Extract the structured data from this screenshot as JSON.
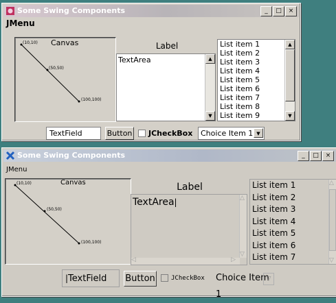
{
  "window_top": {
    "title": "Some Swing Components",
    "controls": [
      "_",
      "□",
      "×"
    ],
    "menu": "JMenu",
    "canvas": {
      "title": "Canvas",
      "points": [
        "(10,10)",
        "(50,50)",
        "(100,100)"
      ]
    },
    "label": "Label",
    "textarea": "TextArea",
    "list": [
      "List item 1",
      "List item 2",
      "List item 3",
      "List item 4",
      "List item 5",
      "List item 6",
      "List item 7",
      "List item 8",
      "List item 9"
    ],
    "textfield": "TextField",
    "button": "Button",
    "checkbox": "JCheckBox",
    "choice": "Choice Item 1"
  },
  "window_bottom": {
    "title": "Some Swing Components",
    "controls": [
      "_",
      "□",
      "×"
    ],
    "menu": "JMenu",
    "canvas": {
      "title": "Canvas",
      "points": [
        "(10,10)",
        "(50,50)",
        "(100,100)"
      ]
    },
    "label": "Label",
    "textarea": "TextArea",
    "list": [
      "List item 1",
      "List item 2",
      "List item 3",
      "List item 4",
      "List item 5",
      "List item 6",
      "List item 7"
    ],
    "textfield": "TextField",
    "button": "Button",
    "checkbox": "JCheckBox",
    "choice": "Choice Item 1"
  }
}
